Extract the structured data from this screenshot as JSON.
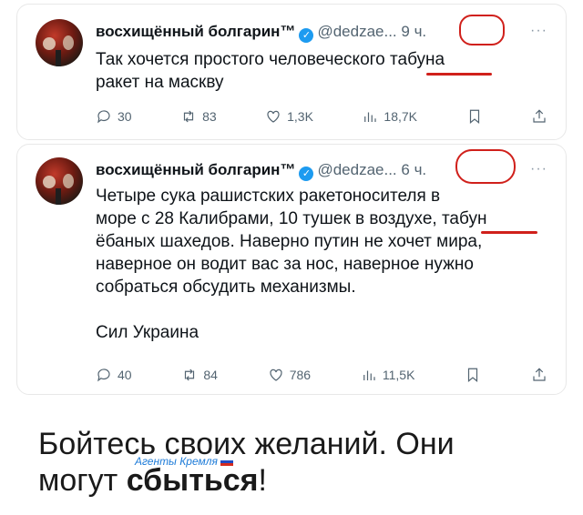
{
  "tweets": [
    {
      "author_name": "восхищённый болгарин™",
      "verified_icon": "verified-badge-icon",
      "handle": "@dedzae...",
      "time": "9 ч.",
      "more": "···",
      "lines": [
        "Так хочется простого человеческого табуна",
        "ракет на маскву"
      ],
      "stats": {
        "replies": "30",
        "reposts": "83",
        "likes": "1,3K",
        "views": "18,7K"
      }
    },
    {
      "author_name": "восхищённый болгарин™",
      "verified_icon": "verified-badge-icon",
      "handle": "@dedzae...",
      "time": "6 ч.",
      "more": "···",
      "lines": [
        "Четыре сука рашистских ракетоносителя в",
        "море с 28 Калибрами, 10 тушек в воздухе, табун",
        "ёбаных шахедов. Наверно путин не хочет мира,",
        "наверное он водит вас за нос, наверное нужно",
        "собраться обсудить механизмы.",
        "",
        "Сил Украина"
      ],
      "stats": {
        "replies": "40",
        "reposts": "84",
        "likes": "786",
        "views": "11,5K"
      }
    }
  ],
  "caption": {
    "line1": "Бойтесь своих желаний. Они",
    "line2_normal": "могут ",
    "line2_bold": "сбыться",
    "line2_end": "!"
  },
  "watermark": "Агенты Кремля",
  "colors": {
    "annotation": "#d0201b",
    "verified": "#1d9bf0",
    "muted": "#536471"
  }
}
